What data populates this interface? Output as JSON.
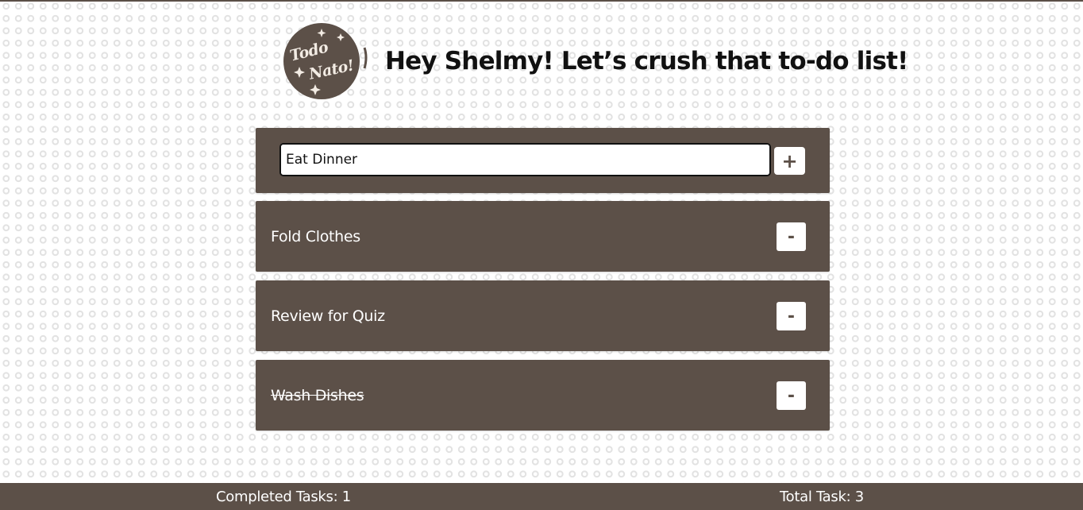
{
  "header": {
    "logo": {
      "line1": "Todo",
      "line2": "Nato!"
    },
    "greeting": "Hey Shelmy! Let’s crush that to-do list!"
  },
  "new_task": {
    "value": "Eat Dinner",
    "add_label": "+"
  },
  "tasks": [
    {
      "label": "Fold Clothes",
      "completed": false,
      "remove_label": "-"
    },
    {
      "label": "Review for Quiz",
      "completed": false,
      "remove_label": "-"
    },
    {
      "label": "Wash Dishes",
      "completed": true,
      "remove_label": "-"
    }
  ],
  "footer": {
    "completed": "Completed Tasks: 1",
    "total": "Total Task: 3"
  },
  "colors": {
    "panel": "#5c5048",
    "text_light": "#ffffff",
    "text_dark": "#111111",
    "logo_text": "#f3ece4"
  }
}
